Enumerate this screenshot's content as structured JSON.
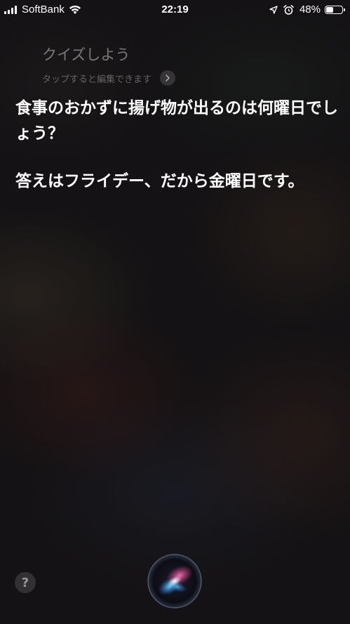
{
  "status_bar": {
    "carrier": "SoftBank",
    "time": "22:19",
    "battery_percent": "48%",
    "battery_level": 0.48,
    "icons": [
      "signal-bars-icon",
      "wifi-icon",
      "location-arrow-icon",
      "alarm-clock-icon",
      "battery-icon"
    ]
  },
  "request": {
    "query": "クイズしよう",
    "edit_hint": "タップすると編集できます",
    "edit_icon": "chevron-right-icon"
  },
  "response": {
    "line1": "食事のおかずに揚げ物が出るのは何曜日でしょう？",
    "line2": "答えはフライデー、だから金曜日です。"
  },
  "controls": {
    "help_label": "?",
    "siri_icon": "siri-orb-icon"
  },
  "colors": {
    "background": "#141214",
    "text": "#ffffff",
    "query_text": "rgba(255,255,255,0.42)",
    "siri_pink": "#e83b8a",
    "siri_blue": "#3f7bff",
    "siri_cyan": "#5fe3ff"
  }
}
